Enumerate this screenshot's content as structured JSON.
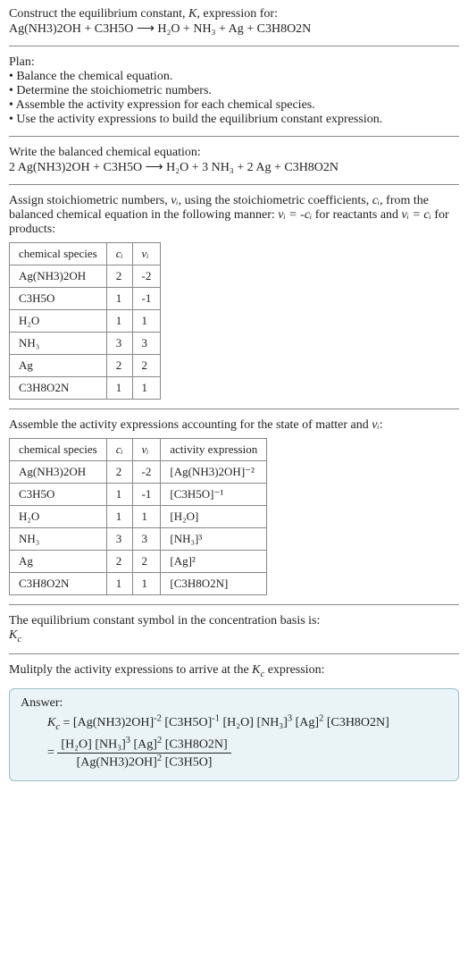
{
  "header": {
    "prompt": "Construct the equilibrium constant, K, expression for:",
    "equation": "Ag(NH3)2OH + C3H5O  ⟶  H₂O + NH₃ + Ag + C3H8O2N"
  },
  "plan": {
    "title": "Plan:",
    "items": [
      "• Balance the chemical equation.",
      "• Determine the stoichiometric numbers.",
      "• Assemble the activity expression for each chemical species.",
      "• Use the activity expressions to build the equilibrium constant expression."
    ]
  },
  "balanced": {
    "title": "Write the balanced chemical equation:",
    "equation": "2 Ag(NH3)2OH + C3H5O  ⟶  H₂O + 3 NH₃ + 2 Ag + C3H8O2N"
  },
  "stoich": {
    "text_pre": "Assign stoichiometric numbers, ",
    "nu": "νᵢ",
    "text_mid1": ", using the stoichiometric coefficients, ",
    "ci": "cᵢ",
    "text_mid2": ", from the balanced chemical equation in the following manner: ",
    "rel1": "νᵢ = -cᵢ",
    "text_mid3": " for reactants and ",
    "rel2": "νᵢ = cᵢ",
    "text_mid4": " for products:",
    "headers": [
      "chemical species",
      "cᵢ",
      "νᵢ"
    ],
    "rows": [
      [
        "Ag(NH3)2OH",
        "2",
        "-2"
      ],
      [
        "C3H5O",
        "1",
        "-1"
      ],
      [
        "H₂O",
        "1",
        "1"
      ],
      [
        "NH₃",
        "3",
        "3"
      ],
      [
        "Ag",
        "2",
        "2"
      ],
      [
        "C3H8O2N",
        "1",
        "1"
      ]
    ]
  },
  "activity": {
    "title_pre": "Assemble the activity expressions accounting for the state of matter and ",
    "title_nu": "νᵢ",
    "title_post": ":",
    "headers": [
      "chemical species",
      "cᵢ",
      "νᵢ",
      "activity expression"
    ],
    "rows": [
      [
        "Ag(NH3)2OH",
        "2",
        "-2",
        "[Ag(NH3)2OH]⁻²"
      ],
      [
        "C3H5O",
        "1",
        "-1",
        "[C3H5O]⁻¹"
      ],
      [
        "H₂O",
        "1",
        "1",
        "[H₂O]"
      ],
      [
        "NH₃",
        "3",
        "3",
        "[NH₃]³"
      ],
      [
        "Ag",
        "2",
        "2",
        "[Ag]²"
      ],
      [
        "C3H8O2N",
        "1",
        "1",
        "[C3H8O2N]"
      ]
    ]
  },
  "basis": {
    "line1": "The equilibrium constant symbol in the concentration basis is:",
    "symbol": "K_c"
  },
  "multiply": {
    "text_pre": "Mulitply the activity expressions to arrive at the ",
    "kc": "K_c",
    "text_post": " expression:"
  },
  "answer": {
    "label": "Answer:",
    "line1": "K_c = [Ag(NH3)2OH]⁻² [C3H5O]⁻¹ [H₂O] [NH₃]³ [Ag]² [C3H8O2N]",
    "eq_prefix": "= ",
    "numerator": "[H₂O] [NH₃]³ [Ag]² [C3H8O2N]",
    "denominator": "[Ag(NH3)2OH]² [C3H5O]"
  },
  "chart_data": {
    "type": "table",
    "tables": [
      {
        "title": "Stoichiometric numbers",
        "headers": [
          "chemical species",
          "c_i",
          "nu_i"
        ],
        "rows": [
          [
            "Ag(NH3)2OH",
            2,
            -2
          ],
          [
            "C3H5O",
            1,
            -1
          ],
          [
            "H2O",
            1,
            1
          ],
          [
            "NH3",
            3,
            3
          ],
          [
            "Ag",
            2,
            2
          ],
          [
            "C3H8O2N",
            1,
            1
          ]
        ]
      },
      {
        "title": "Activity expressions",
        "headers": [
          "chemical species",
          "c_i",
          "nu_i",
          "activity expression"
        ],
        "rows": [
          [
            "Ag(NH3)2OH",
            2,
            -2,
            "[Ag(NH3)2OH]^-2"
          ],
          [
            "C3H5O",
            1,
            -1,
            "[C3H5O]^-1"
          ],
          [
            "H2O",
            1,
            1,
            "[H2O]"
          ],
          [
            "NH3",
            3,
            3,
            "[NH3]^3"
          ],
          [
            "Ag",
            2,
            2,
            "[Ag]^2"
          ],
          [
            "C3H8O2N",
            1,
            1,
            "[C3H8O2N]"
          ]
        ]
      }
    ]
  }
}
